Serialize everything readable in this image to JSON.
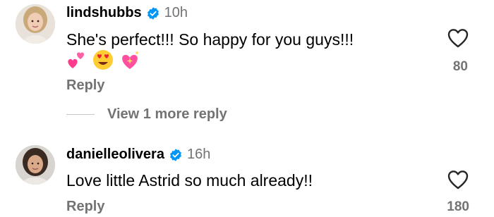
{
  "comments": [
    {
      "username": "lindshubbs",
      "verified": true,
      "time": "10h",
      "text": "She's perfect!!! So happy for you guys!!!",
      "emojis": [
        "two-hearts",
        "heart-eyes-face",
        "sparkling-heart"
      ],
      "reply_label": "Reply",
      "likes": "80"
    },
    {
      "username": "danielleolivera",
      "verified": true,
      "time": "16h",
      "text": "Love little Astrid so much already!!",
      "reply_label": "Reply",
      "likes": "180"
    }
  ],
  "view_more_label": "View 1 more reply",
  "colors": {
    "verified": "#0095f6",
    "muted": "#737373",
    "heart_pink": "#ff3b8d"
  }
}
